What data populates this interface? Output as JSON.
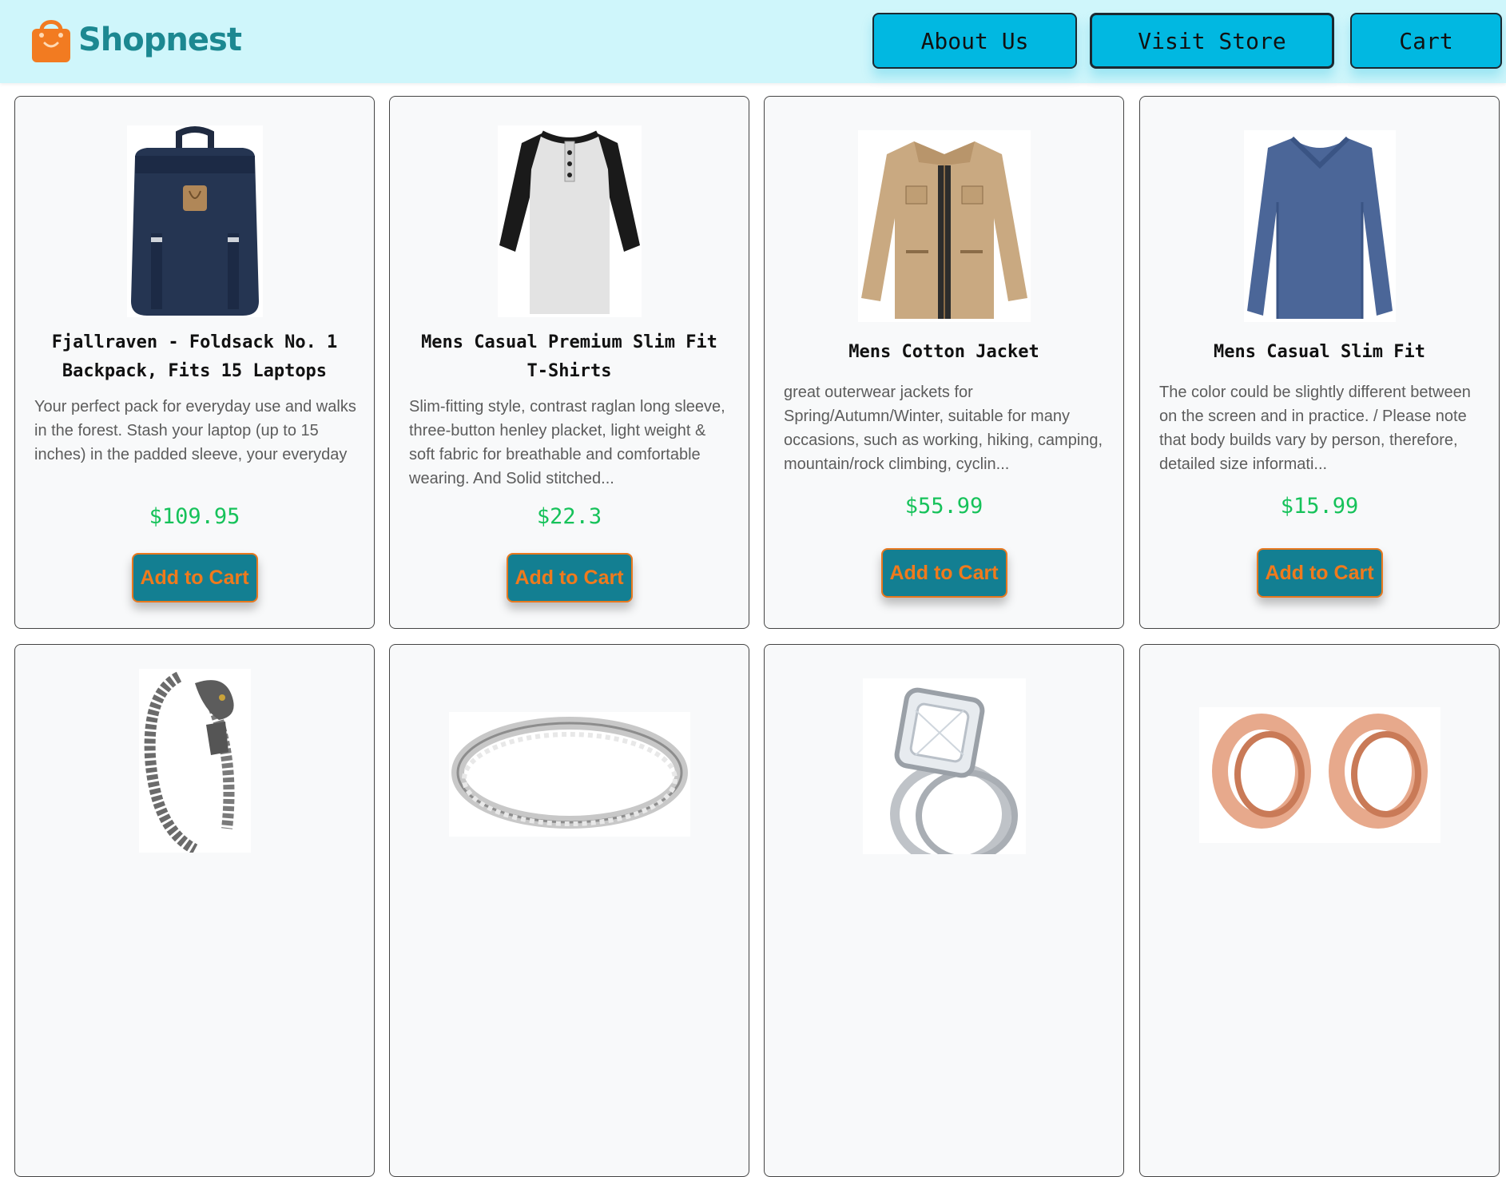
{
  "header": {
    "brand": "Shopnest",
    "nav": [
      "About Us",
      "Visit Store",
      "Cart"
    ]
  },
  "products": [
    {
      "title": "Fjallraven - Foldsack No. 1 Backpack, Fits 15 Laptops",
      "description": "Your perfect pack for everyday use and walks in the forest. Stash your laptop (up to 15 inches) in the padded sleeve, your everyday",
      "price": "$109.95",
      "button": "Add to Cart",
      "image": "backpack-image"
    },
    {
      "title": "Mens Casual Premium Slim Fit T-Shirts",
      "description": "Slim-fitting style, contrast raglan long sleeve, three-button henley placket, light weight & soft fabric for breathable and comfortable wearing. And Solid stitched...",
      "price": "$22.3",
      "button": "Add to Cart",
      "image": "tshirt-image"
    },
    {
      "title": "Mens Cotton Jacket",
      "description": "great outerwear jackets for Spring/Autumn/Winter, suitable for many occasions, such as working, hiking, camping, mountain/rock climbing, cyclin...",
      "price": "$55.99",
      "button": "Add to Cart",
      "image": "jacket-image"
    },
    {
      "title": "Mens Casual Slim Fit",
      "description": "The color could be slightly different between on the screen and in practice. / Please note that body builds vary by person, therefore, detailed size informati...",
      "price": "$15.99",
      "button": "Add to Cart",
      "image": "longsleeve-image"
    },
    {
      "image": "bracelet-image"
    },
    {
      "image": "ring-image"
    },
    {
      "image": "diamond-ring-image"
    },
    {
      "image": "ear-plugs-image"
    }
  ],
  "colors": {
    "header_bg": "#cff6fb",
    "nav_button": "#01b8e1",
    "brand_text": "#1c8891",
    "price": "#16c25a",
    "add_button_bg": "#137f92",
    "add_button_text": "#f07a1c"
  }
}
